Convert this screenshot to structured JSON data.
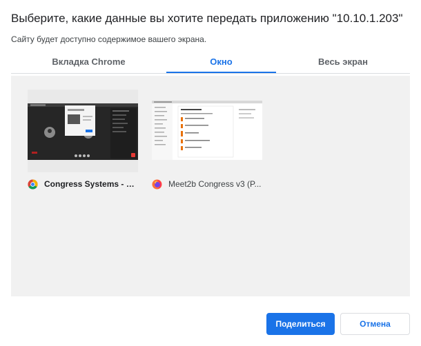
{
  "dialog": {
    "title": "Выберите, какие данные вы хотите передать приложению \"10.10.1.203\"",
    "subtitle": "Сайту будет доступно содержимое вашего экрана."
  },
  "tabs": [
    {
      "label": "Вкладка Chrome",
      "selected": false
    },
    {
      "label": "Окно",
      "selected": true
    },
    {
      "label": "Весь экран",
      "selected": false
    }
  ],
  "sources": [
    {
      "label": "Congress Systems - m...",
      "icon": "chrome-icon",
      "selected": false
    },
    {
      "label": "Meet2b Congress v3 (P...",
      "icon": "firefox-icon",
      "selected": false
    }
  ],
  "buttons": {
    "share_label": "Поделиться",
    "cancel_label": "Отмена"
  },
  "colors": {
    "accent": "#1a73e8",
    "panel_background": "#f1f1f1"
  }
}
